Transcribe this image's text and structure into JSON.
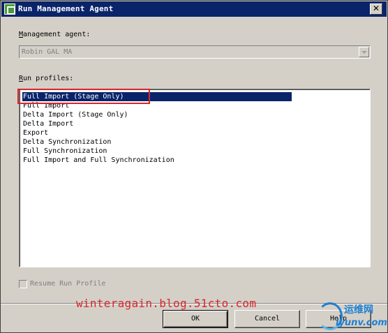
{
  "window": {
    "title": "Run Management Agent",
    "close_glyph": "✕"
  },
  "management_agent": {
    "label_accel": "M",
    "label_rest": "anagement agent:",
    "value": "Robin GAL MA"
  },
  "run_profiles": {
    "label_accel": "R",
    "label_rest": "un profiles:",
    "items": [
      "Full Import (Stage Only)",
      "Full Import",
      "Delta Import (Stage Only)",
      "Delta Import",
      "Export",
      "Delta Synchronization",
      "Full Synchronization",
      "Full Import and Full Synchronization"
    ],
    "selected_index": 0
  },
  "resume": {
    "label": "Resume Run Profile"
  },
  "buttons": {
    "ok": "OK",
    "cancel": "Cancel",
    "help": "Help"
  },
  "watermark": {
    "text": "winteragain.blog.51cto.com"
  },
  "logo": {
    "top": "运维网",
    "bottom": "iyunv.com"
  },
  "colors": {
    "selection": "#0a246a",
    "annotation": "#d9262b",
    "dialog_bg": "#d4d0c8"
  }
}
